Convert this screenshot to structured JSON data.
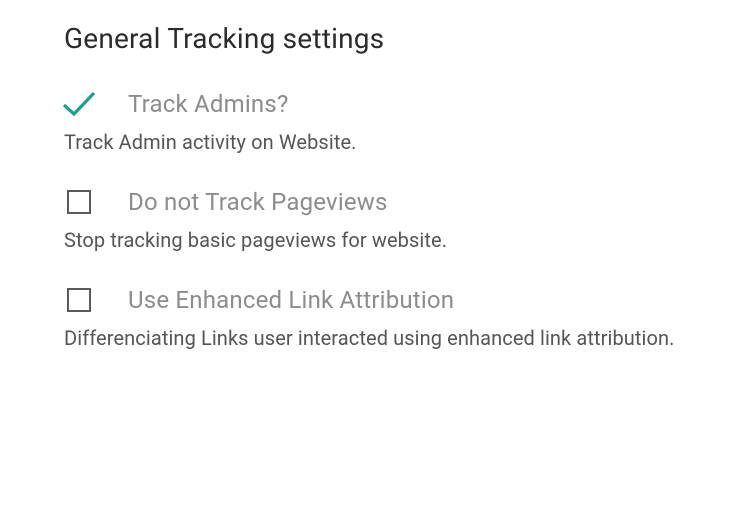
{
  "heading": "General Tracking settings",
  "options": [
    {
      "label": "Track Admins?",
      "description": "Track Admin activity on Website.",
      "checked": true
    },
    {
      "label": "Do not Track Pageviews",
      "description": "Stop tracking basic pageviews for website.",
      "checked": false
    },
    {
      "label": "Use Enhanced Link Attribution",
      "description": "Differenciating Links user interacted using enhanced link attribution.",
      "checked": false
    }
  ],
  "colors": {
    "accent": "#1aa289"
  }
}
